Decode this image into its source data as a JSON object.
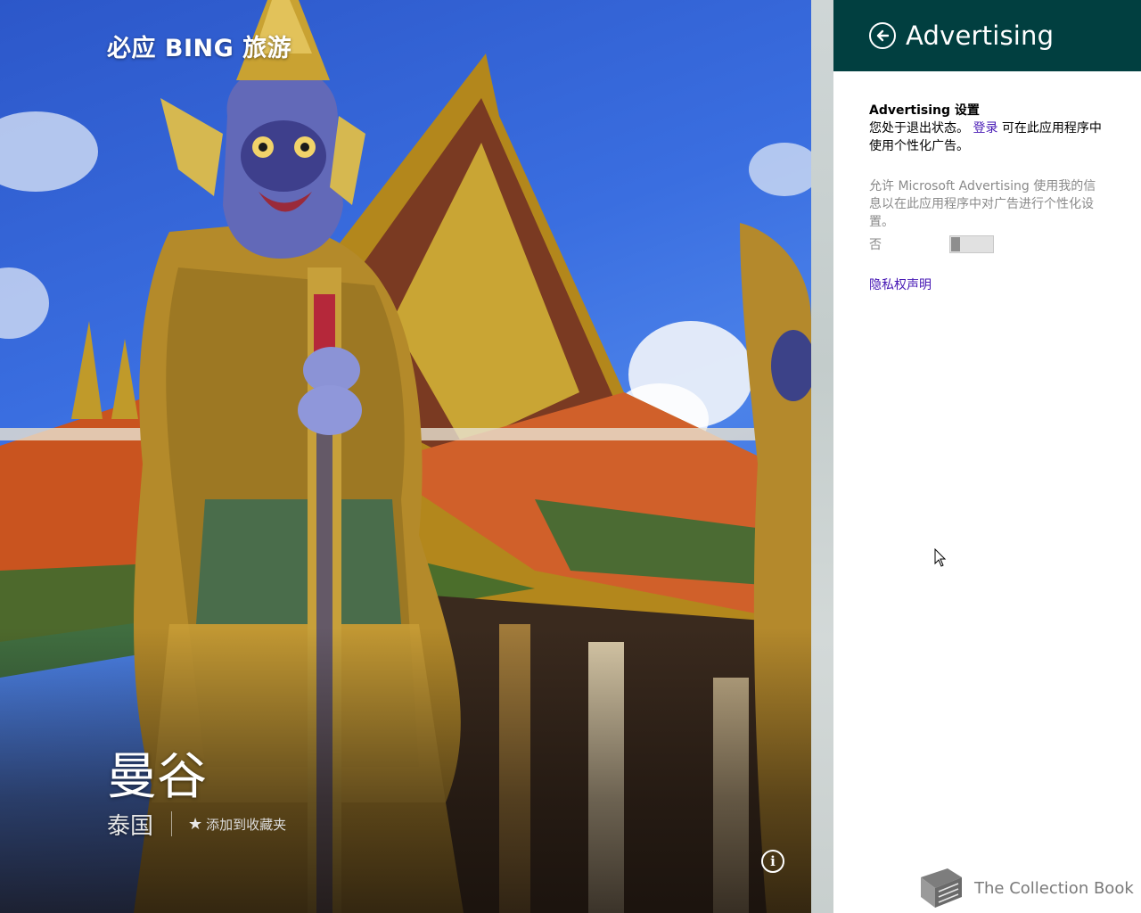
{
  "app": {
    "title": "必应 BING 旅游"
  },
  "destination": {
    "city": "曼谷",
    "country": "泰国",
    "add_favorite_label": "添加到收藏夹",
    "info_icon_glyph": "i"
  },
  "settings_panel": {
    "title": "Advertising",
    "section_title": "Advertising 设置",
    "status_prefix": "您处于退出状态。",
    "signin_link": "登录",
    "status_suffix": "可在此应用程序中使用个性化广告。",
    "allow_description": "允许 Microsoft Advertising 使用我的信息以在此应用程序中对广告进行个性化设置。",
    "toggle_state_label": "否",
    "toggle_on": false,
    "privacy_link": "隐私权声明",
    "header_color": "#013f40",
    "link_color": "#4617b4"
  },
  "watermark": {
    "text": "The Collection Book"
  },
  "icons": {
    "back": "back-arrow-circle-icon",
    "star": "star-add-icon",
    "info": "info-icon",
    "book": "book-icon"
  }
}
